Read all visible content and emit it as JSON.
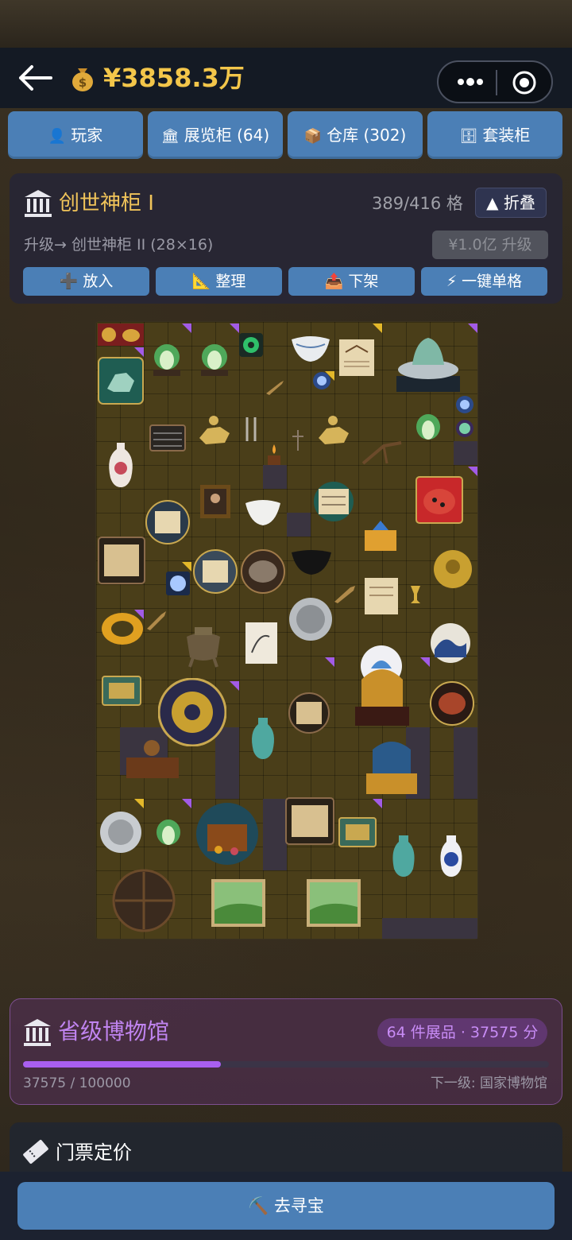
{
  "header": {
    "back_icon": "arrow-left-icon",
    "money_icon": "money-bag-icon",
    "money": "¥3858.3万",
    "menu_icon": "more-dots-icon",
    "close_icon": "target-circle-icon"
  },
  "tabs": [
    {
      "icon": "👤",
      "label": "玩家"
    },
    {
      "icon": "🏛",
      "label": "展览柜 (64)"
    },
    {
      "icon": "📦",
      "label": "仓库 (302)"
    },
    {
      "icon": "🗄",
      "label": "套装柜"
    }
  ],
  "cabinet": {
    "title": "创世神柜 I",
    "capacity": "389/416 格",
    "fold_label": "▲ 折叠",
    "upgrade_text": "升级→ 创世神柜 II (28×16)",
    "upgrade_button": "¥1.0亿 升级",
    "actions": [
      {
        "icon": "➕",
        "label": "放入"
      },
      {
        "icon": "📐",
        "label": "整理"
      },
      {
        "icon": "📤",
        "label": "下架"
      },
      {
        "icon": "⚡",
        "label": "一键单格"
      }
    ]
  },
  "museum": {
    "title": "省级博物馆",
    "badge": "64 件展品 · 37575 分",
    "score": "37575 / 100000",
    "progress_fraction": 0.37575,
    "next_level": "下一级: 国家博物馆"
  },
  "ticket": {
    "title": "门票定价"
  },
  "bottom": {
    "button": "⛏️ 去寻宝"
  },
  "colors": {
    "accent_blue": "#4b7fb6",
    "gold": "#f3c64a",
    "purple": "#a95ff0",
    "rarity_purple": "#a25be6",
    "rarity_gold": "#e3b82a"
  }
}
